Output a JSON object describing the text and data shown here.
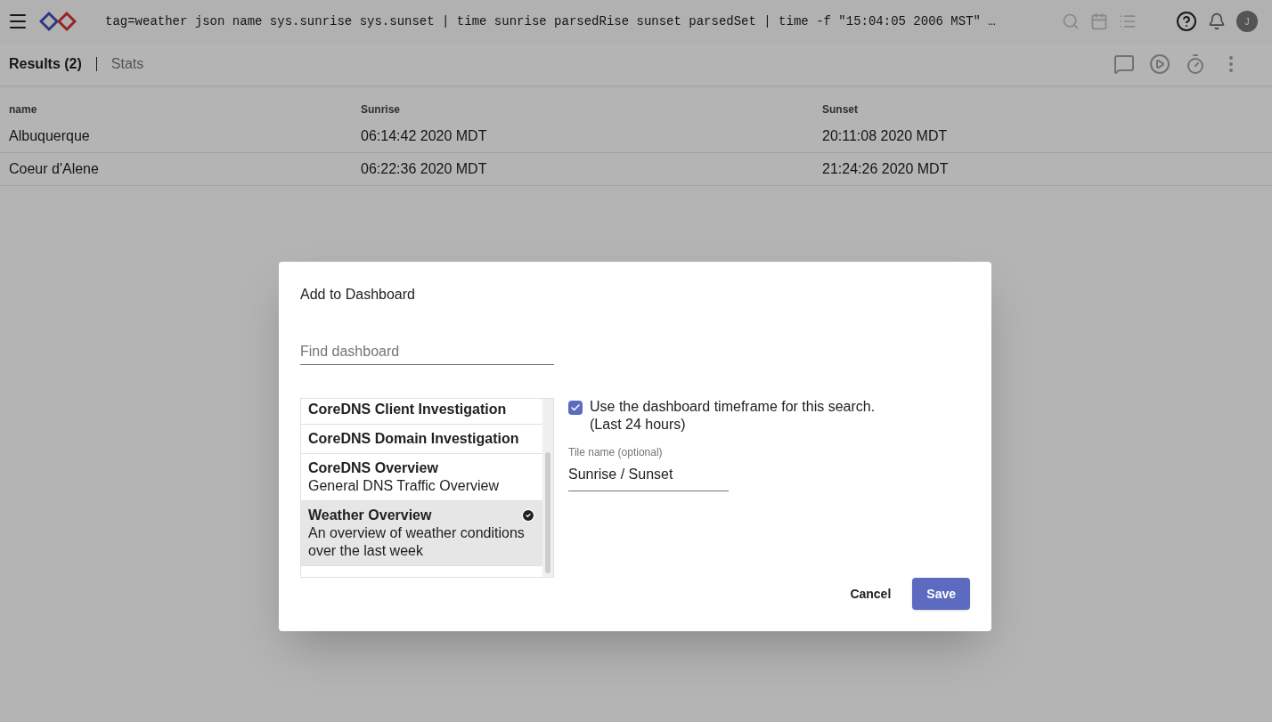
{
  "top_bar": {
    "query": "tag=weather json name sys.sunrise sys.sunset | time sunrise parsedRise sunset parsedSet | time -f \"15:04:05 2006 MST\" …",
    "avatar": "J"
  },
  "tabs": [
    {
      "label": "Results (2)",
      "selected": true
    },
    {
      "label": "Stats",
      "selected": false
    }
  ],
  "table": {
    "columns": [
      "name",
      "Sunrise",
      "Sunset"
    ],
    "rows": [
      [
        "Albuquerque",
        "06:14:42 2020 MDT",
        "20:11:08 2020 MDT"
      ],
      [
        "Coeur d'Alene",
        "06:22:36 2020 MDT",
        "21:24:26 2020 MDT"
      ]
    ]
  },
  "dialog": {
    "title": "Add to Dashboard",
    "search": {
      "placeholder": "Find dashboard"
    },
    "dashboards": [
      {
        "title": "CoreDNS Client Investigation",
        "selected": false
      },
      {
        "title": "CoreDNS Domain Investigation",
        "selected": false
      },
      {
        "title": "CoreDNS Overview",
        "description": "General DNS Traffic Overview",
        "selected": false
      },
      {
        "title": "Weather Overview",
        "description": "An overview of weather conditions over the last week",
        "selected": true
      }
    ],
    "timeframe": {
      "label": "Use the dashboard timeframe for this search.",
      "sublabel": "(Last 24 hours)",
      "checked": true
    },
    "tile_name": {
      "label": "Tile name (optional)",
      "value": "Sunrise / Sunset"
    },
    "buttons": [
      "Cancel",
      "Save"
    ]
  }
}
